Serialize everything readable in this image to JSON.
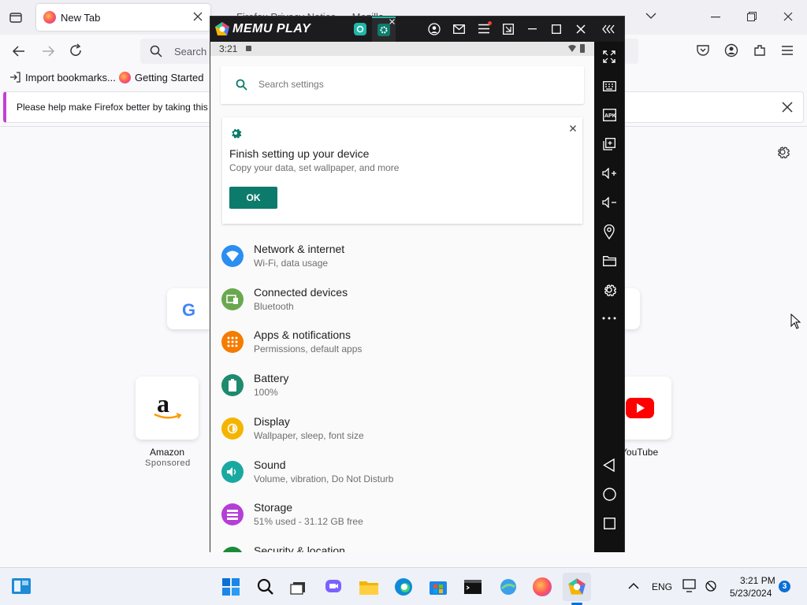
{
  "browser": {
    "tab_title": "New Tab",
    "second_tab_fragment": "Firefox Privacy Notice — Mozilla",
    "address_placeholder": "Search",
    "bookmarks": [
      "Import bookmarks...",
      "Getting Started"
    ],
    "notification": "Please help make Firefox better by taking this s",
    "shortcuts": [
      {
        "label": "Amazon",
        "sub": "Sponsored"
      },
      {
        "label": "YouTube",
        "sub": ""
      }
    ]
  },
  "memu": {
    "brand": "MEMU PLAY",
    "status_time": "3:21",
    "search_placeholder": "Search settings",
    "setup_card": {
      "title": "Finish setting up your device",
      "subtitle": "Copy your data, set wallpaper, and more",
      "button": "OK"
    },
    "settings": [
      {
        "title": "Network & internet",
        "sub": "Wi‑Fi, data usage",
        "color": "#2b8ef0",
        "icon": "wifi-icon"
      },
      {
        "title": "Connected devices",
        "sub": "Bluetooth",
        "color": "#6aa84f",
        "icon": "devices-icon"
      },
      {
        "title": "Apps & notifications",
        "sub": "Permissions, default apps",
        "color": "#f57c00",
        "icon": "apps-icon"
      },
      {
        "title": "Battery",
        "sub": "100%",
        "color": "#1e8a6e",
        "icon": "battery-icon"
      },
      {
        "title": "Display",
        "sub": "Wallpaper, sleep, font size",
        "color": "#f5b400",
        "icon": "brightness-icon"
      },
      {
        "title": "Sound",
        "sub": "Volume, vibration, Do Not Disturb",
        "color": "#19a9a0",
        "icon": "volume-icon"
      },
      {
        "title": "Storage",
        "sub": "51% used - 31.12 GB free",
        "color": "#b43fd6",
        "icon": "storage-icon"
      },
      {
        "title": "Security & location",
        "sub": "",
        "color": "#1a8a3a",
        "icon": "lock-icon"
      }
    ]
  },
  "taskbar": {
    "language": "ENG",
    "time": "3:21 PM",
    "date": "5/23/2024",
    "notifications": "3"
  },
  "colors": {
    "teal": "#0d7b6c",
    "memu_accent": "#1fb7a6"
  }
}
